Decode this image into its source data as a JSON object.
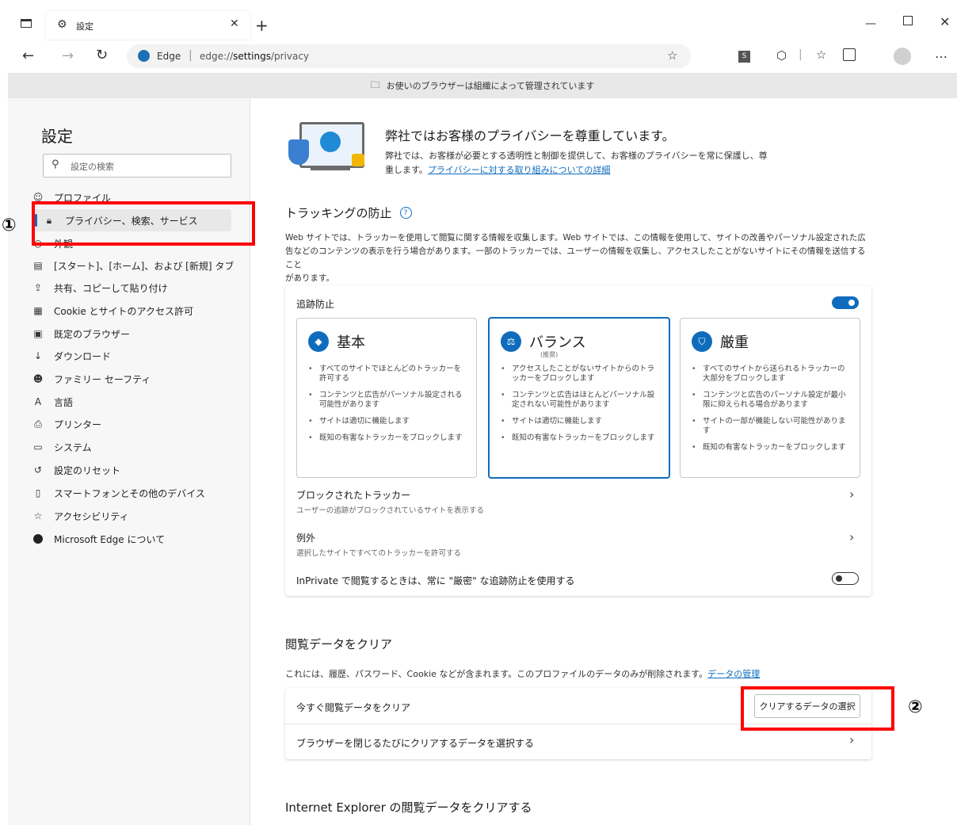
{
  "browser": {
    "tab_title": "設定",
    "new_tab_symbol": "+",
    "address_brand": "Edge",
    "address_url_prefix": "edge://",
    "address_url_bold": "settings",
    "address_url_suffix": "/privacy",
    "managed_notice": "お使いのブラウザーは組織によって管理されています"
  },
  "sidebar": {
    "title": "設定",
    "search_placeholder": "設定の検索",
    "items": [
      {
        "label": "プロファイル"
      },
      {
        "label": "プライバシー、検索、サービス"
      },
      {
        "label": "外観"
      },
      {
        "label": "[スタート]、[ホーム]、および [新規] タブ"
      },
      {
        "label": "共有、コピーして貼り付け"
      },
      {
        "label": "Cookie とサイトのアクセス許可"
      },
      {
        "label": "既定のブラウザー"
      },
      {
        "label": "ダウンロード"
      },
      {
        "label": "ファミリー セーフティ"
      },
      {
        "label": "言語"
      },
      {
        "label": "プリンター"
      },
      {
        "label": "システム"
      },
      {
        "label": "設定のリセット"
      },
      {
        "label": "スマートフォンとその他のデバイス"
      },
      {
        "label": "アクセシビリティ"
      },
      {
        "label": "Microsoft Edge について"
      }
    ]
  },
  "hero": {
    "title": "弊社ではお客様のプライバシーを尊重しています。",
    "body_line1": "弊社では、お客様が必要とする透明性と制御を提供して、お客様のプライバシーを常に保護し、尊",
    "body_line2": "重します。",
    "link": "プライバシーに対する取り組みについての詳細"
  },
  "tracking": {
    "heading": "トラッキングの防止",
    "help_symbol": "?",
    "desc_line1": "Web サイトでは、トラッカーを使用して閲覧に関する情報を収集します。Web サイトでは、この情報を使用して、サイトの改善やパーソナル設定された広",
    "desc_line2": "告などのコンテンツの表示を行う場合があります。一部のトラッカーでは、ユーザーの情報を収集し、アクセスしたことがないサイトにその情報を送信すること",
    "desc_line3": "があります。",
    "card_title": "追跡防止",
    "toggle_on": true,
    "levels": [
      {
        "name": "基本",
        "subtitle": "",
        "bullets": [
          "すべてのサイトでほとんどのトラッカーを許可する",
          "コンテンツと広告がパーソナル設定される可能性があります",
          "サイトは適切に機能します",
          "既知の有害なトラッカーをブロックします"
        ]
      },
      {
        "name": "バランス",
        "subtitle": "(推奨)",
        "bullets": [
          "アクセスしたことがないサイトからのトラッカーをブロックします",
          "コンテンツと広告はほとんどパーソナル設定されない可能性があります",
          "サイトは適切に機能します",
          "既知の有害なトラッカーをブロックします"
        ]
      },
      {
        "name": "厳重",
        "subtitle": "",
        "bullets": [
          "すべてのサイトから送られるトラッカーの大部分をブロックします",
          "コンテンツと広告のパーソナル設定が最小限に抑えられる場合があります",
          "サイトの一部が機能しない可能性があります",
          "既知の有害なトラッカーをブロックします"
        ]
      }
    ],
    "blocked_title": "ブロックされたトラッカー",
    "blocked_sub": "ユーザーの追跡がブロックされているサイトを表示する",
    "exceptions_title": "例外",
    "exceptions_sub": "選択したサイトですべてのトラッカーを許可する",
    "inprivate_label": "InPrivate で閲覧するときは、常に \"厳密\" な追跡防止を使用する",
    "inprivate_on": false
  },
  "clear": {
    "heading": "閲覧データをクリア",
    "desc": "これには、履歴、パスワード、Cookie などが含まれます。このプロファイルのデータのみが削除されます。",
    "desc_link": "データの管理",
    "now_label": "今すぐ閲覧データをクリア",
    "choose_button": "クリアするデータの選択",
    "on_close_label": "ブラウザーを閉じるたびにクリアするデータを選択する"
  },
  "ie": {
    "heading": "Internet Explorer の閲覧データをクリアする"
  },
  "annotations": {
    "marker1": "①",
    "marker2": "②"
  },
  "colors": {
    "accent": "#0f6cbd",
    "annotation_red": "#ff0000"
  }
}
